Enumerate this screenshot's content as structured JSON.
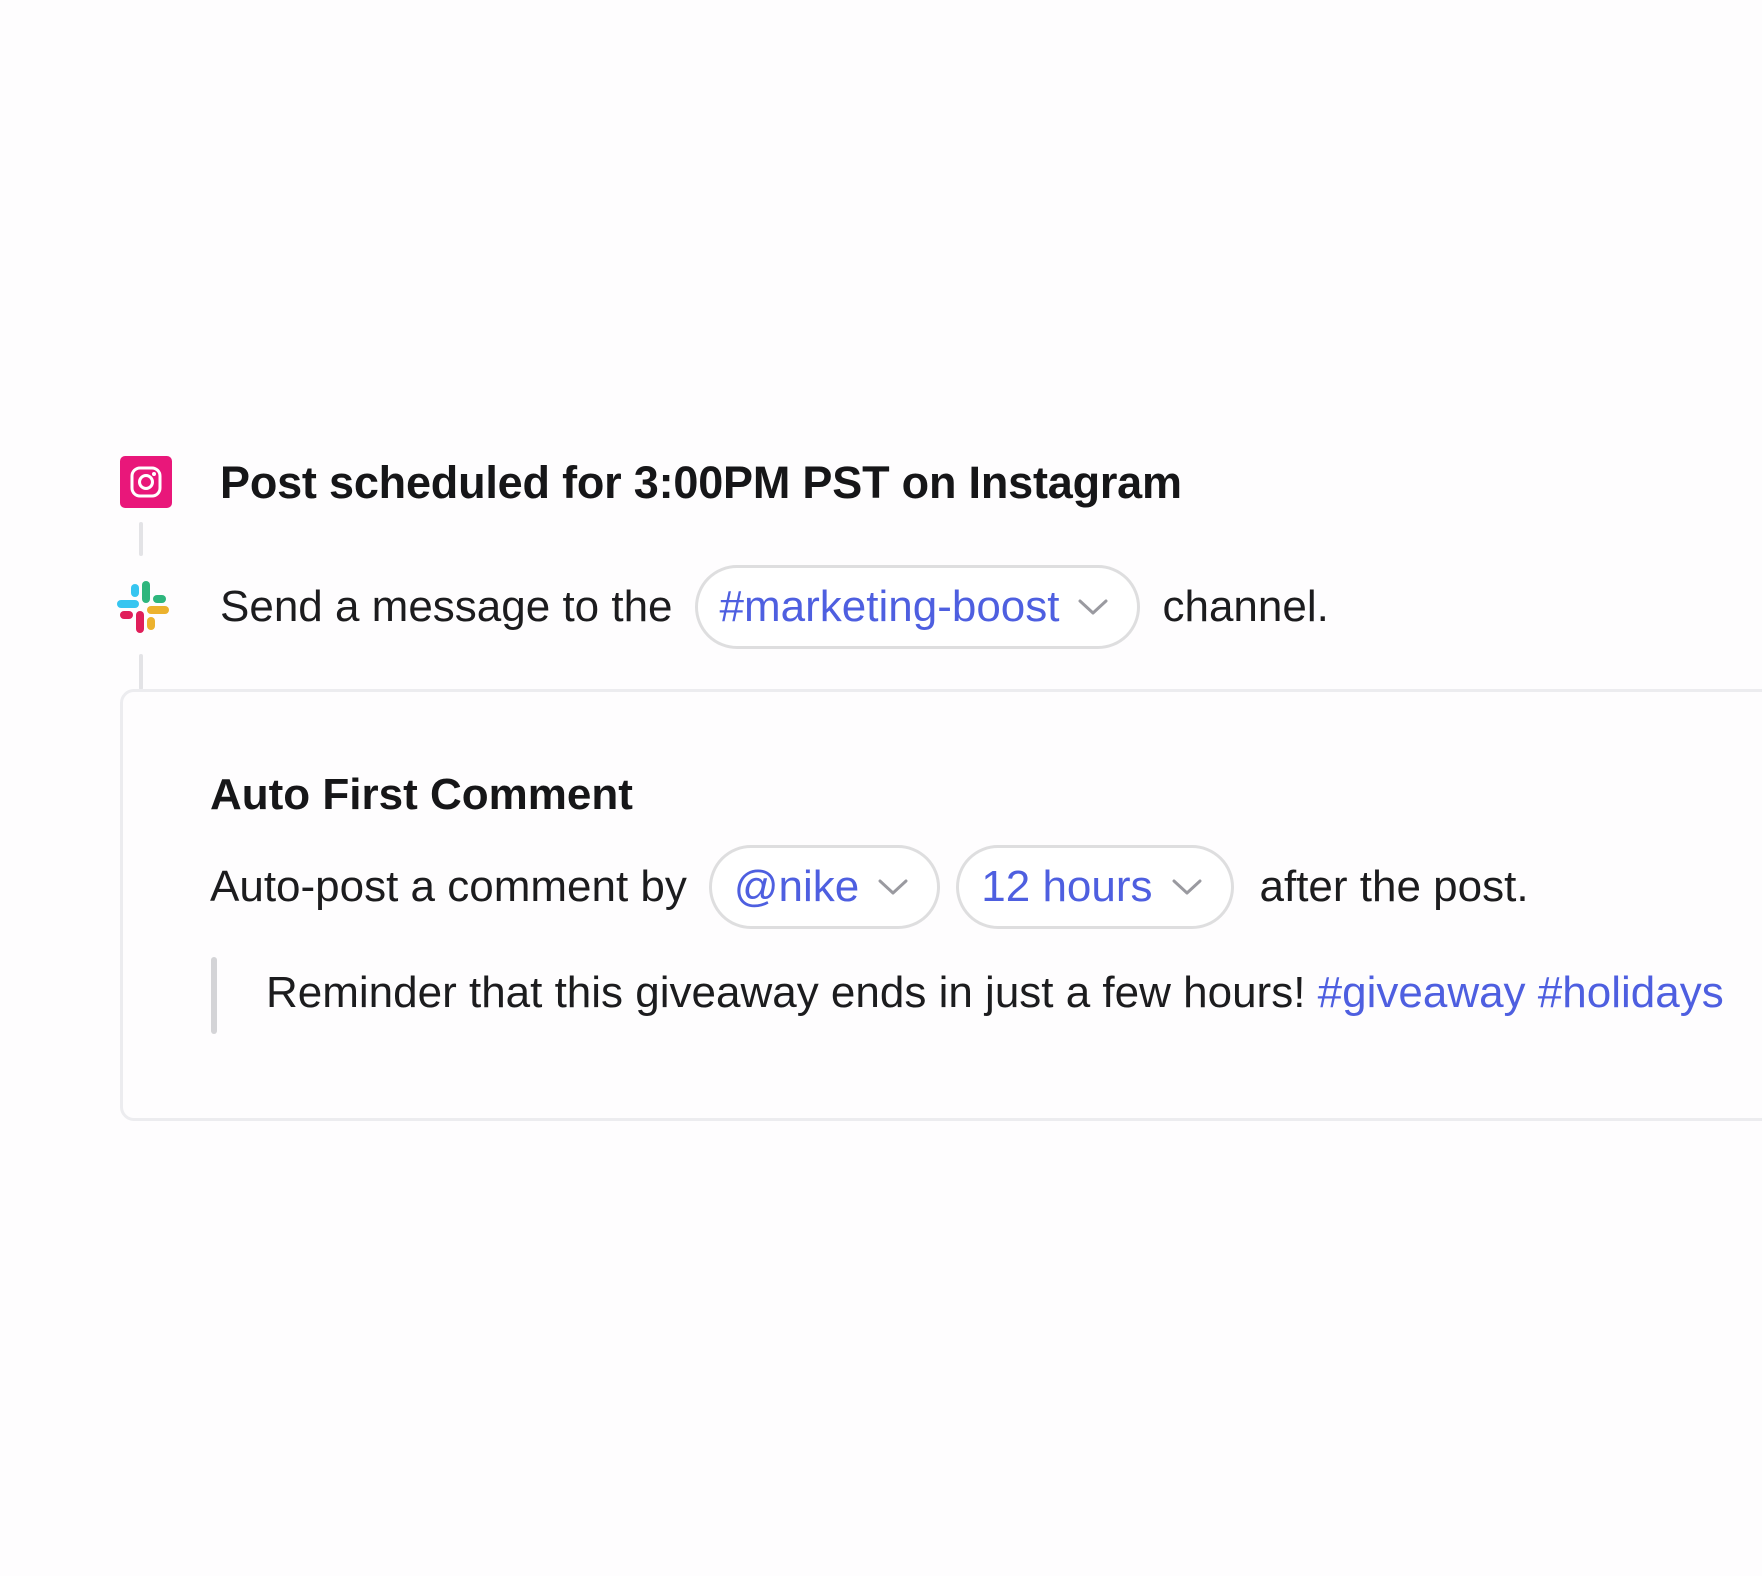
{
  "trigger": {
    "icon": "instagram-icon",
    "title": "Post scheduled for 3:00PM PST on Instagram"
  },
  "slack_step": {
    "icon": "slack-icon",
    "prefix": "Send a message to the",
    "channel": "#marketing-boost",
    "suffix": "channel."
  },
  "auto_comment": {
    "title": "Auto First Comment",
    "prefix": "Auto-post a comment by",
    "account": "@nike",
    "delay": "12 hours",
    "suffix": "after the post.",
    "message": "Reminder that this giveaway ends in just a few hours!",
    "hashtags": "#giveaway #holidays"
  },
  "colors": {
    "accent": "#4e5fe0",
    "instagram": "#e9177a",
    "border": "#dededf",
    "background": "#fefdfe"
  }
}
